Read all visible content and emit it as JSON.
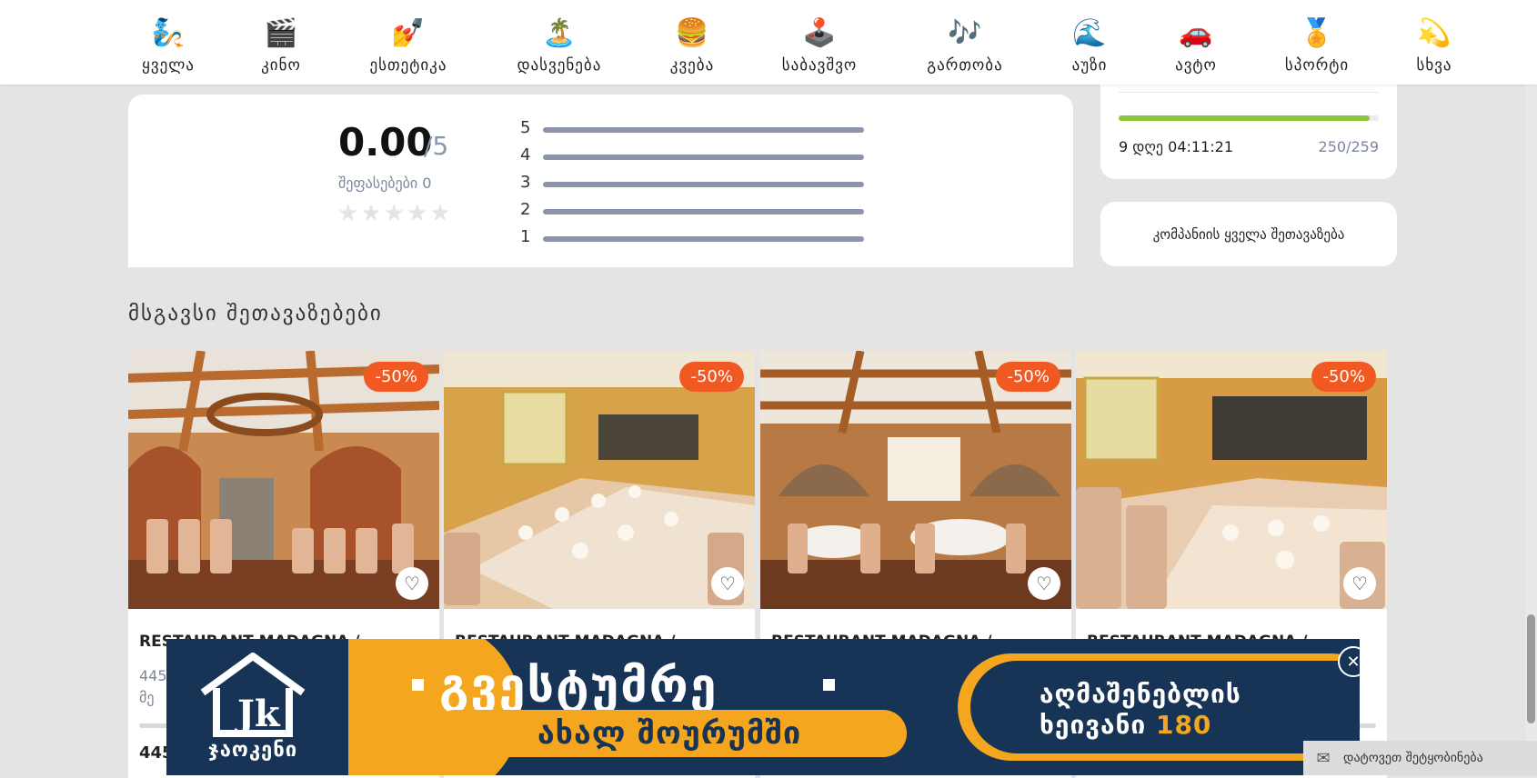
{
  "nav": {
    "categories": [
      {
        "label": "ყველა",
        "icon": "🧞"
      },
      {
        "label": "კინო",
        "icon": "🎬"
      },
      {
        "label": "ესთეტიკა",
        "icon": "💅"
      },
      {
        "label": "დასვენება",
        "icon": "🏝️"
      },
      {
        "label": "კვება",
        "icon": "🍔"
      },
      {
        "label": "საბავშვო",
        "icon": "🕹️"
      },
      {
        "label": "გართობა",
        "icon": "🎶"
      },
      {
        "label": "აუზი",
        "icon": "🌊"
      },
      {
        "label": "ავტო",
        "icon": "🚗"
      },
      {
        "label": "სპორტი",
        "icon": "🏅"
      },
      {
        "label": "სხვა",
        "icon": "💫"
      }
    ]
  },
  "rating": {
    "score": "0.00",
    "max": "/5",
    "reviews_label": "შეფასებები 0",
    "stars": [
      "★",
      "★",
      "★",
      "★",
      "★"
    ],
    "bars": [
      {
        "label": "5",
        "value": 0
      },
      {
        "label": "4",
        "value": 0
      },
      {
        "label": "3",
        "value": 0
      },
      {
        "label": "2",
        "value": 0
      },
      {
        "label": "1",
        "value": 0
      }
    ]
  },
  "timer": {
    "time_left": "9 დღე 04:11:21",
    "count": "250/259",
    "progress_fraction": 0.965
  },
  "all_offers_label": "კომპანიის ყველა შეთავაზება",
  "section_title": "მსგავსი შეთავაზებები",
  "offers": [
    {
      "discount": "-50%",
      "title": "RESTAURANT MADAGNA /",
      "addr1": "445",
      "addr2": "მე",
      "price": "445"
    },
    {
      "discount": "-50%",
      "title": "RESTAURANT MADAGNA /",
      "addr1": "",
      "addr2": "",
      "price": ""
    },
    {
      "discount": "-50%",
      "title": "RESTAURANT MADAGNA /",
      "addr1": "",
      "addr2": "",
      "price": ""
    },
    {
      "discount": "-50%",
      "title": "RESTAURANT MADAGNA /",
      "addr1": "",
      "addr2": "",
      "price": ""
    }
  ],
  "banner": {
    "logo_text": "ჯაოკენი",
    "headline": "გვესტუმრე",
    "sub": "ახალ შოურუმში",
    "right_line1": "აღმაშენებლის",
    "right_line2": "ხეივანი",
    "right_highlight": "180",
    "close_symbol": "✕",
    "colors": {
      "navy": "#173356",
      "yellow": "#f4a71e"
    }
  },
  "leave_message": {
    "label": "დატოვეთ შეტყობინება",
    "icon": "mail-icon"
  },
  "colors": {
    "discount": "#f05a22",
    "progress": "#8cc63f",
    "rating_bar": "#8b94a8"
  }
}
